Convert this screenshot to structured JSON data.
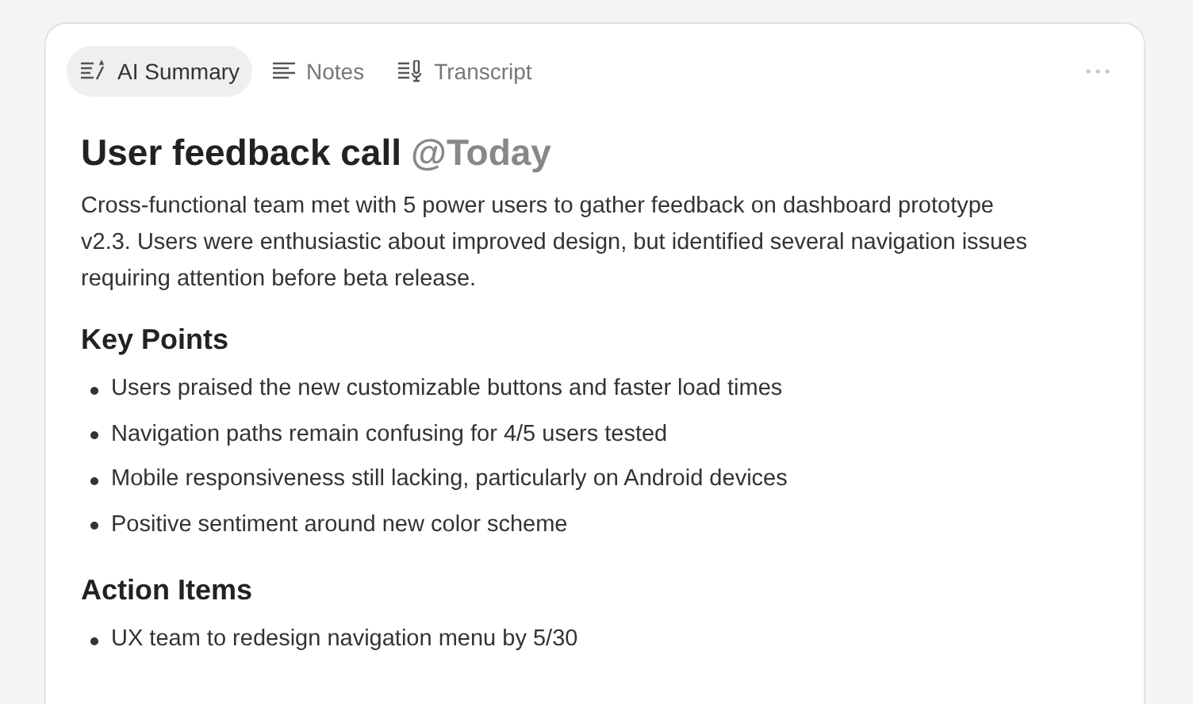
{
  "tabs": [
    {
      "label": "AI Summary",
      "kind": "summary",
      "selected": true
    },
    {
      "label": "Notes",
      "kind": "notes",
      "selected": false
    },
    {
      "label": "Transcript",
      "kind": "transcript",
      "selected": false
    }
  ],
  "title": "User feedback call",
  "date_tag": "@Today",
  "summary": "Cross-functional team met with 5 power users to gather feedback on dashboard prototype v2.3. Users were enthusiastic about improved design, but identified several navigation issues requiring attention before beta release.",
  "sections": [
    {
      "heading": "Key Points",
      "items": [
        "Users praised the new customizable buttons and faster load times",
        "Navigation paths remain confusing for 4/5 users tested",
        "Mobile responsiveness still lacking, particularly on Android devices",
        "Positive sentiment around new color scheme"
      ]
    },
    {
      "heading": "Action Items",
      "items": [
        "UX team to redesign navigation menu by 5/30"
      ]
    }
  ]
}
